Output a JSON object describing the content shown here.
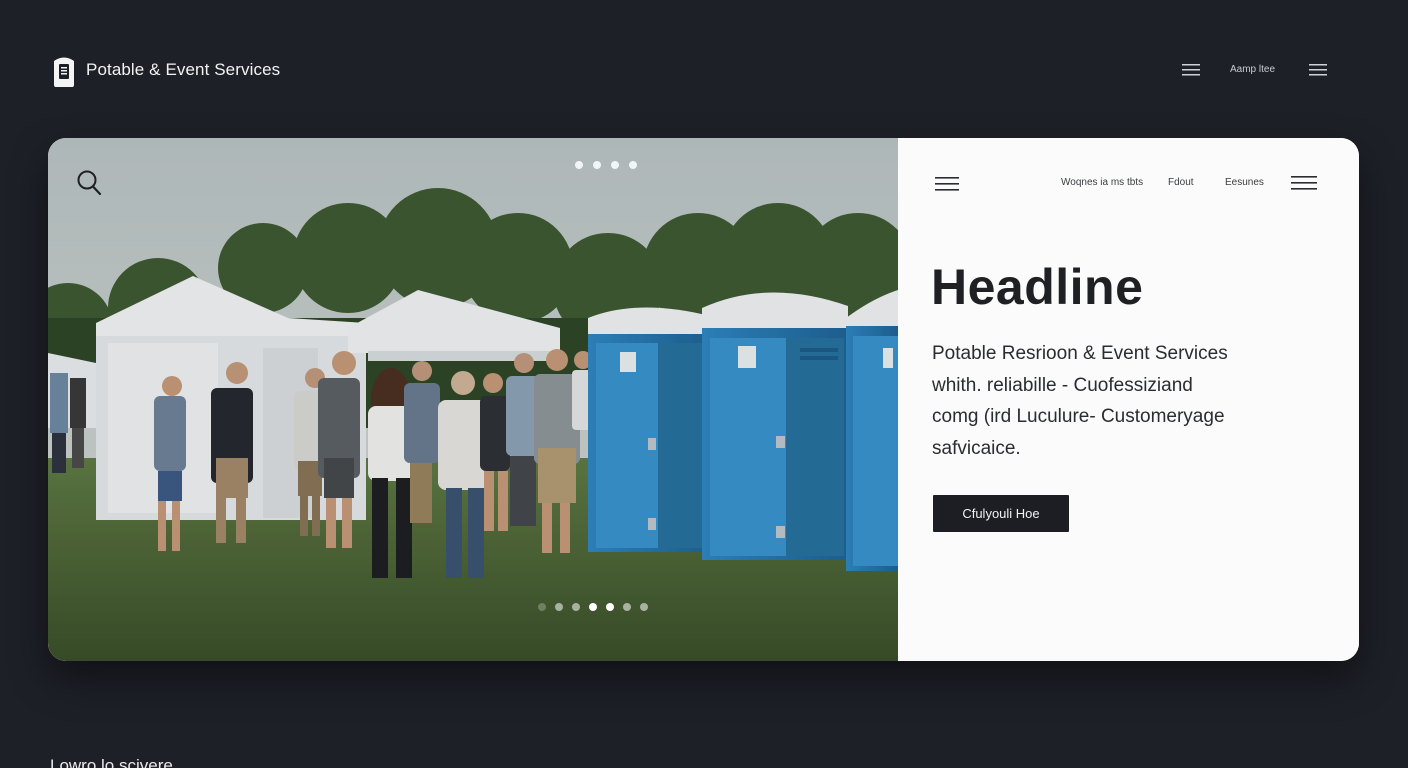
{
  "brand": {
    "name": "Potable & Event Services",
    "logo_icon": "portable-toilet-icon"
  },
  "topnav": {
    "link": "Aamp ltee",
    "menu_icon": "hamburger-menu-icon"
  },
  "hero": {
    "image_description_icon": "event-photo",
    "search_icon": "search-icon",
    "top_dots": 4,
    "bottom_dots": 7,
    "bottom_active_dot": 3
  },
  "panel": {
    "nav": [
      "Woqnes ia ms tbts",
      "Fdout",
      "Eesunes"
    ],
    "headline": "Headline",
    "desc_lines": [
      "Potable Resrioon & Event Services",
      "whith. reliabille - Cuofessiziand",
      "comg (ird Luculure- Customeryage",
      "safvicaice."
    ],
    "cta_label": "Cfulyouli Hoe"
  },
  "section": {
    "title": "Lowro lo scivere"
  },
  "colors": {
    "page_bg": "#1e2028",
    "panel_bg": "#fbfbfb",
    "cta_bg": "#1c1e24",
    "toilet_blue": "#2f86c2"
  }
}
